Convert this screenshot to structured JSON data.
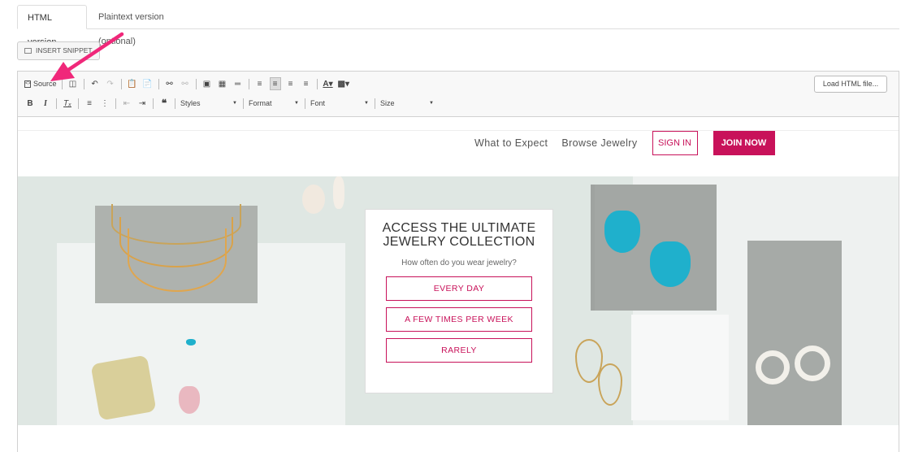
{
  "tabs": {
    "html": "HTML version",
    "plaintext": "Plaintext version (optional)"
  },
  "snippet": {
    "label": "INSERT SNIPPET"
  },
  "toolbar": {
    "source": "Source",
    "load_html": "Load HTML file...",
    "styles": "Styles",
    "format": "Format",
    "font": "Font",
    "size": "Size"
  },
  "site": {
    "nav": {
      "what_to_expect": "What to Expect",
      "browse": "Browse Jewelry",
      "sign_in": "SIGN IN",
      "join_now": "JOIN NOW"
    },
    "card": {
      "title_line1": "ACCESS THE ULTIMATE",
      "title_line2": "JEWELRY COLLECTION",
      "question": "How often do you wear jewelry?",
      "options": [
        "EVERY DAY",
        "A FEW TIMES PER WEEK",
        "RARELY"
      ]
    }
  },
  "colors": {
    "accent": "#c8125a",
    "annotation_arrow": "#f0287a",
    "hero_bg": "#dfe7e3"
  }
}
